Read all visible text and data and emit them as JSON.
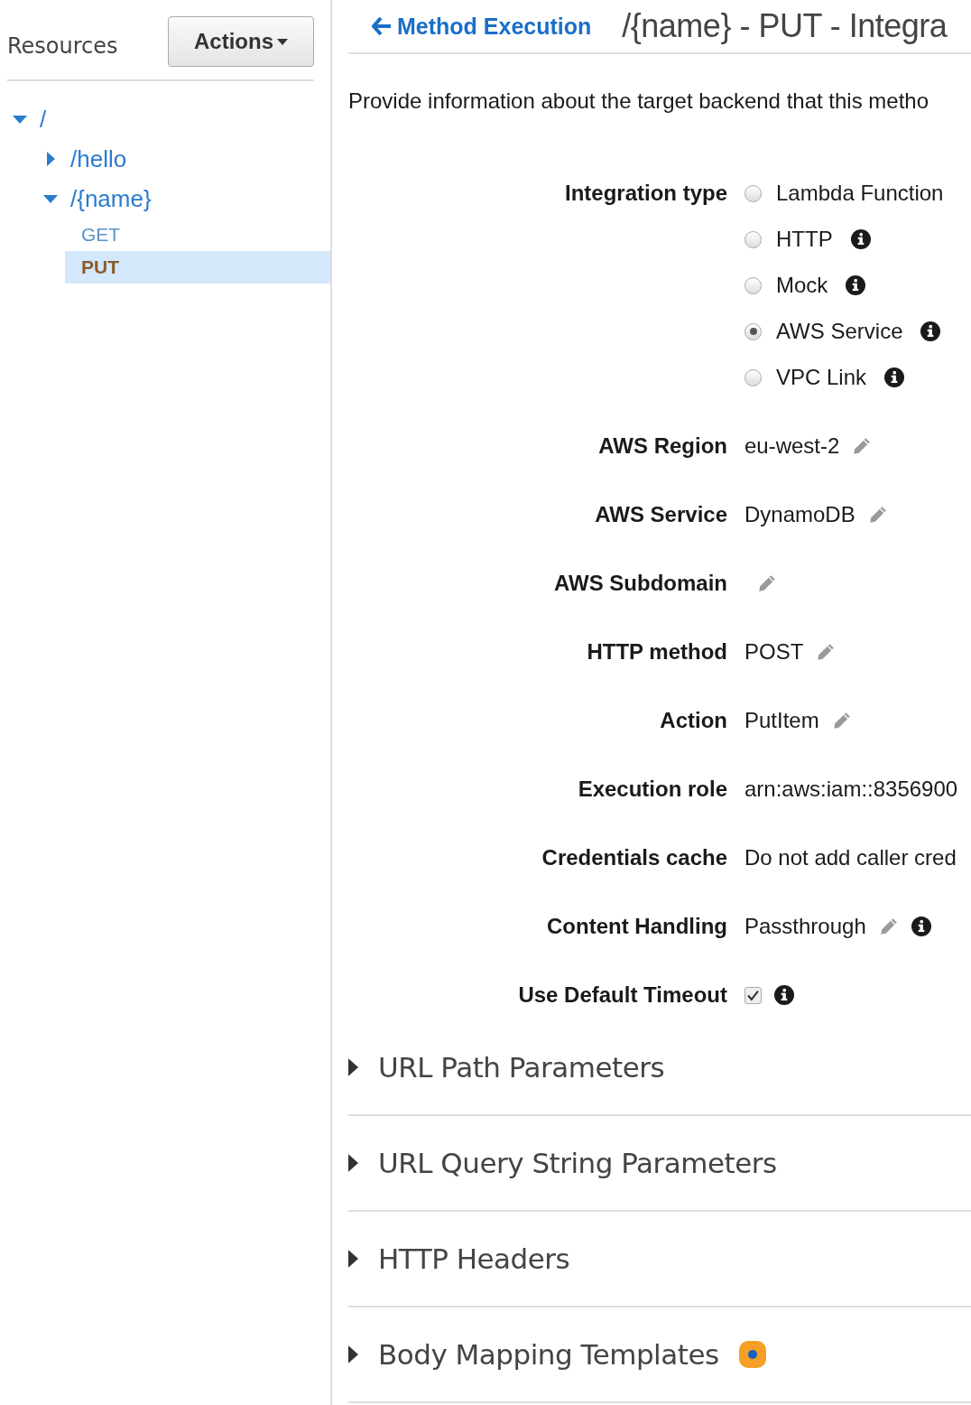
{
  "sidebar": {
    "title": "Resources",
    "actions_button": "Actions",
    "tree": [
      {
        "label": "/",
        "kind": "resource",
        "expanded": true,
        "children": [
          {
            "label": "/hello",
            "kind": "resource",
            "expanded": false
          },
          {
            "label": "/{name}",
            "kind": "resource",
            "expanded": true,
            "children": [
              {
                "label": "GET",
                "kind": "method",
                "selected": false
              },
              {
                "label": "PUT",
                "kind": "method",
                "selected": true
              }
            ]
          }
        ]
      }
    ]
  },
  "header": {
    "back_link": "Method Execution",
    "title": "/{name} - PUT - Integra"
  },
  "description": "Provide information about the target backend that this metho",
  "form": [
    {
      "kind": "radio",
      "label": "Integration type",
      "options": [
        {
          "label": "Lambda Function",
          "selected": false
        },
        {
          "label": "HTTP",
          "selected": false,
          "info": true
        },
        {
          "label": "Mock",
          "selected": false,
          "info": true
        },
        {
          "label": "AWS Service",
          "selected": true,
          "info": true
        },
        {
          "label": "VPC Link",
          "selected": false,
          "info": true
        }
      ]
    },
    {
      "kind": "text",
      "label": "AWS Region",
      "value": "eu-west-2",
      "editable": true
    },
    {
      "kind": "text",
      "label": "AWS Service",
      "value": "DynamoDB",
      "editable": true
    },
    {
      "kind": "text",
      "label": "AWS Subdomain",
      "editable": true
    },
    {
      "kind": "text",
      "label": "HTTP method",
      "value": "POST",
      "editable": true
    },
    {
      "kind": "text",
      "label": "Action",
      "value": "PutItem",
      "editable": true
    },
    {
      "kind": "text",
      "label": "Execution role",
      "value": "arn:aws:iam::8356900"
    },
    {
      "kind": "text",
      "label": "Credentials cache",
      "value": "Do not add caller cred"
    },
    {
      "kind": "text",
      "label": "Content Handling",
      "value": "Passthrough",
      "editable": true,
      "info": true
    },
    {
      "kind": "checkbox",
      "label": "Use Default Timeout",
      "checked": true,
      "info": true
    }
  ],
  "sections": [
    {
      "title": "URL Path Parameters",
      "expanded": false
    },
    {
      "title": "URL Query String Parameters",
      "expanded": false
    },
    {
      "title": "HTTP Headers",
      "expanded": false
    },
    {
      "title": "Body Mapping Templates",
      "expanded": false,
      "indicator": true
    }
  ]
}
